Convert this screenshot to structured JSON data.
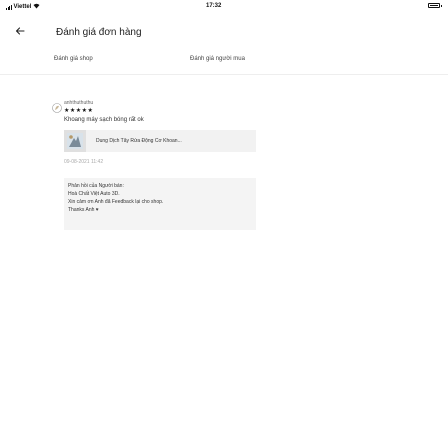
{
  "status_bar": {
    "carrier": "Viettel",
    "time": "17:32"
  },
  "header": {
    "title": "Đánh giá đơn hàng"
  },
  "tabs": [
    {
      "label": "Đánh giá shop"
    },
    {
      "label": "Đánh giá người mua"
    }
  ],
  "review": {
    "username": "anhthuthuthu",
    "rating": 5,
    "stars": "★★★★★",
    "text": "Khoang máy sạch bóng rất ok",
    "product_name": "Dung Dịch Tẩy Rửa Động Cơ Khoan...",
    "date": "09-08-2021 11:42",
    "reply": {
      "lines": [
        "Phản hồi của Người bán:",
        "Hoà Chất Việt Auto 3D.",
        "Xin cảm ơn Anh đã Feedback lại cho shop.",
        "Thanks Anh"
      ]
    }
  }
}
